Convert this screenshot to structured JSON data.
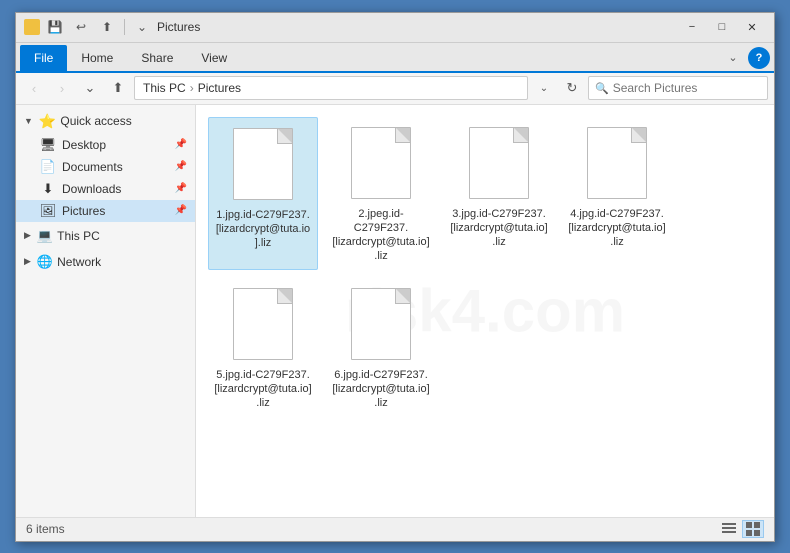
{
  "titleBar": {
    "title": "Pictures",
    "icon": "📁",
    "minimizeLabel": "−",
    "maximizeLabel": "□",
    "closeLabel": "✕"
  },
  "quickAccessBar": {
    "buttons": [
      "📁",
      "↩",
      "⬆"
    ]
  },
  "ribbonTabs": {
    "tabs": [
      {
        "label": "File",
        "active": true
      },
      {
        "label": "Home",
        "active": false
      },
      {
        "label": "Share",
        "active": false
      },
      {
        "label": "View",
        "active": false
      }
    ],
    "chevronLabel": "⌄",
    "helpLabel": "?"
  },
  "addressBar": {
    "backLabel": "‹",
    "forwardLabel": "›",
    "upLabel": "⌃",
    "pathParts": [
      "This PC",
      "Pictures"
    ],
    "dropdownLabel": "⌄",
    "refreshLabel": "↻",
    "searchPlaceholder": "Search Pictures"
  },
  "sidebar": {
    "sections": [
      {
        "header": "Quick access",
        "headerIcon": "⭐",
        "items": [
          {
            "label": "Desktop",
            "icon": "🖥",
            "pinned": true
          },
          {
            "label": "Documents",
            "icon": "📄",
            "pinned": true
          },
          {
            "label": "Downloads",
            "icon": "⬇",
            "pinned": true
          },
          {
            "label": "Pictures",
            "icon": "🖼",
            "pinned": true,
            "active": true
          }
        ]
      },
      {
        "header": "This PC",
        "headerIcon": "💻",
        "items": []
      },
      {
        "header": "Network",
        "headerIcon": "🌐",
        "items": []
      }
    ]
  },
  "fileGrid": {
    "files": [
      {
        "name": "1.jpg.id-C279F237.[lizardcrypt@tuta.io].liz",
        "selected": true
      },
      {
        "name": "2.jpeg.id-C279F237.[lizardcrypt@tuta.io].liz",
        "selected": false
      },
      {
        "name": "3.jpg.id-C279F237.[lizardcrypt@tuta.io].liz",
        "selected": false
      },
      {
        "name": "4.jpg.id-C279F237.[lizardcrypt@tuta.io].liz",
        "selected": false
      },
      {
        "name": "5.jpg.id-C279F237.[lizardcrypt@tuta.io].liz",
        "selected": false
      },
      {
        "name": "6.jpg.id-C279F237.[lizardcrypt@tuta.io].liz",
        "selected": false
      }
    ]
  },
  "statusBar": {
    "itemCount": "6 items",
    "viewList": "☰",
    "viewGrid": "⊞"
  }
}
